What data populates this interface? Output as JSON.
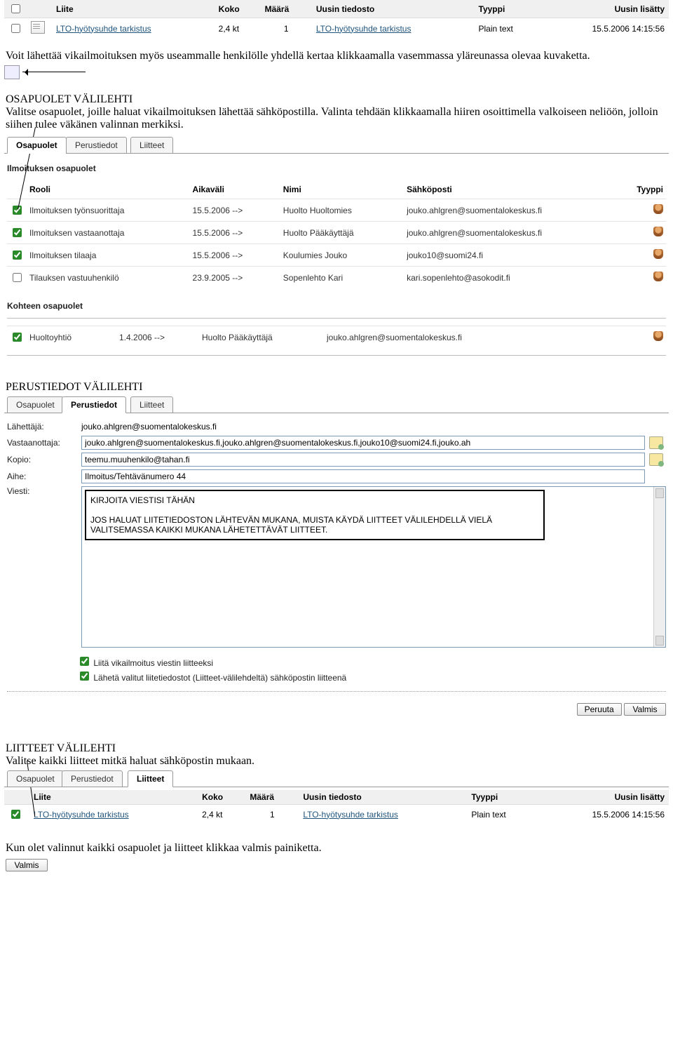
{
  "attach_table_top": {
    "cols": [
      "Liite",
      "Koko",
      "Määrä",
      "Uusin tiedosto",
      "Tyyppi",
      "Uusin lisätty"
    ],
    "rows": [
      {
        "checked": false,
        "liite": "LTO-hyötysuhde tarkistus",
        "koko": "2,4 kt",
        "maara": "1",
        "uusin": "LTO-hyötysuhde tarkistus",
        "tyyppi": "Plain text",
        "lisatty": "15.5.2006 14:15:56"
      }
    ]
  },
  "para1": "Voit lähettää vikailmoituksen myös useammalle henkilölle yhdellä kertaa klikkaamalla vasemmassa yläreunassa olevaa kuvaketta.",
  "hdr_osapuolet": "OSAPUOLET VÄLILEHTI",
  "para2": "Valitse osapuolet, joille haluat vikailmoituksen lähettää sähköpostilla. Valinta tehdään klikkaamalla hiiren osoittimella valkoiseen neliöön, jolloin siihen tulee väkänen valinnan merkiksi.",
  "tabs": {
    "osapuolet": "Osapuolet",
    "perustiedot": "Perustiedot",
    "liitteet": "Liitteet"
  },
  "osap_panel": {
    "title1": "Ilmoituksen osapuolet",
    "cols": [
      "",
      "Rooli",
      "Aikaväli",
      "Nimi",
      "Sähköposti",
      "Tyyppi"
    ],
    "rows": [
      {
        "chk": true,
        "rooli": "Ilmoituksen työnsuorittaja",
        "aika": "15.5.2006 -->",
        "nimi": "Huolto Huoltomies",
        "sp": "jouko.ahlgren@suomentalokeskus.fi"
      },
      {
        "chk": true,
        "rooli": "Ilmoituksen vastaanottaja",
        "aika": "15.5.2006 -->",
        "nimi": "Huolto Pääkäyttäjä",
        "sp": "jouko.ahlgren@suomentalokeskus.fi"
      },
      {
        "chk": true,
        "rooli": "Ilmoituksen tilaaja",
        "aika": "15.5.2006 -->",
        "nimi": "Koulumies Jouko",
        "sp": "jouko10@suomi24.fi"
      },
      {
        "chk": false,
        "rooli": "Tilauksen vastuuhenkilö",
        "aika": "23.9.2005 -->",
        "nimi": "Sopenlehto Kari",
        "sp": "kari.sopenlehto@asokodit.fi"
      }
    ],
    "title2": "Kohteen osapuolet",
    "rows2": [
      {
        "chk": true,
        "rooli": "Huoltoyhtiö",
        "aika": "1.4.2006 -->",
        "nimi": "Huolto Pääkäyttäjä",
        "sp": "jouko.ahlgren@suomentalokeskus.fi"
      }
    ]
  },
  "hdr_perustiedot": "PERUSTIEDOT VÄLILEHTI",
  "form": {
    "labels": {
      "lahettaja": "Lähettäjä:",
      "vastaanottaja": "Vastaanottaja:",
      "kopio": "Kopio:",
      "aihe": "Aihe:",
      "viesti": "Viesti:"
    },
    "lahettaja": "jouko.ahlgren@suomentalokeskus.fi",
    "vastaanottaja": "jouko.ahlgren@suomentalokeskus.fi,jouko.ahlgren@suomentalokeskus.fi,jouko10@suomi24.fi,jouko.ah",
    "kopio": "teemu.muuhenkilo@tahan.fi",
    "aihe": "Ilmoitus/Tehtävänumero 44",
    "viesti_box": "KIRJOITA VIESTISI TÄHÄN\n\nJOS HALUAT LIITETIEDOSTON LÄHTEVÄN MUKANA, MUISTA KÄYDÄ LIITTEET VÄLILEHDELLÄ VIELÄ VALITSEMASSA KAIKKI MUKANA LÄHETETTÄVÄT LIITTEET.",
    "opt1": "Liitä vikailmoitus viestin liitteeksi",
    "opt2": "Lähetä valitut liitetiedostot (Liitteet-välilehdeltä) sähköpostin liitteenä",
    "btn_cancel": "Peruuta",
    "btn_ok": "Valmis"
  },
  "hdr_liitteet": "LIITTEET VÄLILEHTI",
  "para3": "Valitse kaikki liitteet mitkä haluat sähköpostin mukaan.",
  "attach_table_bottom": {
    "cols": [
      "Liite",
      "Koko",
      "Määrä",
      "Uusin tiedosto",
      "Tyyppi",
      "Uusin lisätty"
    ],
    "rows": [
      {
        "checked": true,
        "liite": "LTO-hyötysuhde tarkistus",
        "koko": "2,4 kt",
        "maara": "1",
        "uusin": "LTO-hyötysuhde tarkistus",
        "tyyppi": "Plain text",
        "lisatty": "15.5.2006 14:15:56"
      }
    ]
  },
  "para4": "Kun olet valinnut kaikki osapuolet ja liitteet klikkaa valmis painiketta.",
  "btn_final": "Valmis"
}
